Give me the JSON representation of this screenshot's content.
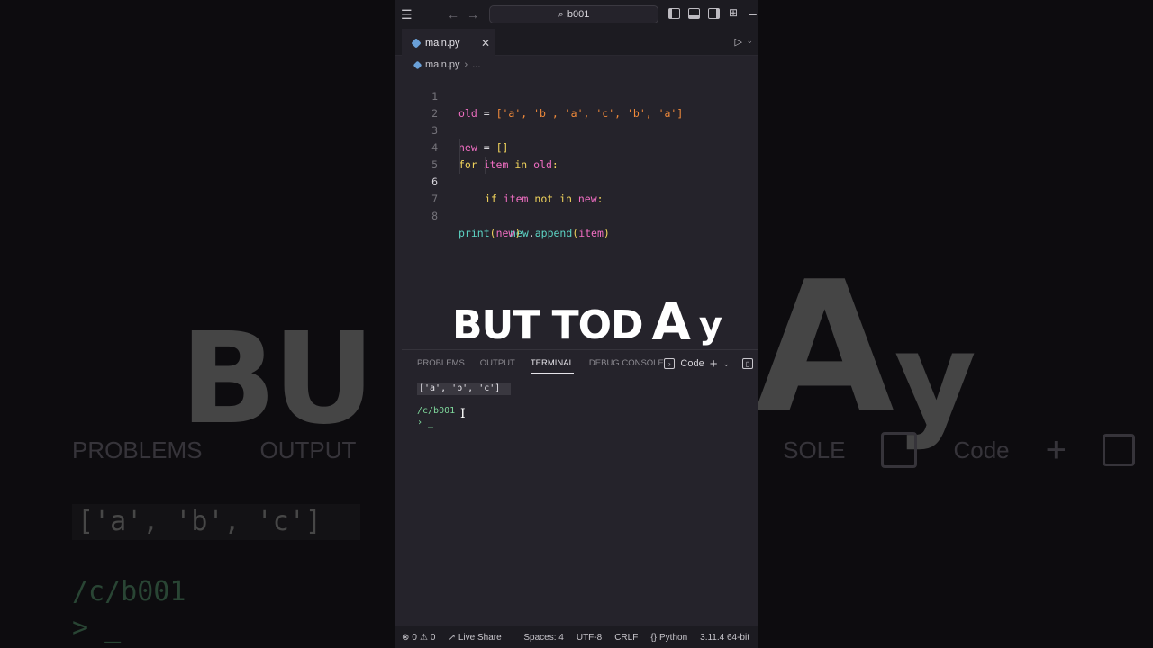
{
  "window": {
    "search_text": "b001"
  },
  "tab": {
    "filename": "main.py"
  },
  "breadcrumb": {
    "file": "main.py",
    "more": "..."
  },
  "editor": {
    "active_line": 6,
    "lines": [
      {
        "num": "1"
      },
      {
        "num": "2"
      },
      {
        "num": "3"
      },
      {
        "num": "4"
      },
      {
        "num": "5"
      },
      {
        "num": "6"
      },
      {
        "num": "7"
      },
      {
        "num": "8"
      }
    ],
    "code": {
      "l1_var": "old",
      "l1_eq": " = ",
      "l1_open": "[",
      "l1_items": "'a', 'b', 'a', 'c', 'b', 'a'",
      "l1_close": "]",
      "l3_var": "new",
      "l3_eq": " = ",
      "l3_brackets": "[]",
      "l4_for": "for",
      "l4_item": " item ",
      "l4_in": "in",
      "l4_old": " old",
      "l4_colon": ":",
      "l5_if": "if",
      "l5_item": " item ",
      "l5_not_in": "not in",
      "l5_new": " new",
      "l5_colon": ":",
      "l6_obj": "new",
      "l6_dot": ".",
      "l6_method": "append",
      "l6_open": "(",
      "l6_arg": "item",
      "l6_close": ")",
      "l8_func": "print",
      "l8_open": "(",
      "l8_arg": "new",
      "l8_close": ")"
    }
  },
  "overlay_caption": {
    "part1": "BUT TOD",
    "part2": "A",
    "part3": "y"
  },
  "panel": {
    "tabs": [
      "PROBLEMS",
      "OUTPUT",
      "TERMINAL",
      "DEBUG CONSOLE"
    ],
    "active_tab": "TERMINAL",
    "terminal_profile": "Code"
  },
  "terminal": {
    "output": "['a', 'b', 'c']",
    "path": "/c/b001",
    "prompt": "› _"
  },
  "statusbar": {
    "errors": "0",
    "warnings": "0",
    "live_share": "Live Share",
    "spaces": "Spaces: 4",
    "encoding": "UTF-8",
    "eol": "CRLF",
    "language": "Python",
    "interpreter": "3.11.4 64-bit"
  },
  "background_mirror": {
    "title_a": "BU",
    "title_b": "A",
    "title_c": "y",
    "tabs": [
      "PROBLEMS",
      "OUTPUT"
    ],
    "tab_right": "SOLE",
    "code_label": "Code",
    "output": "['a', 'b', 'c']",
    "path": "/c/b001",
    "prompt": "> _"
  }
}
